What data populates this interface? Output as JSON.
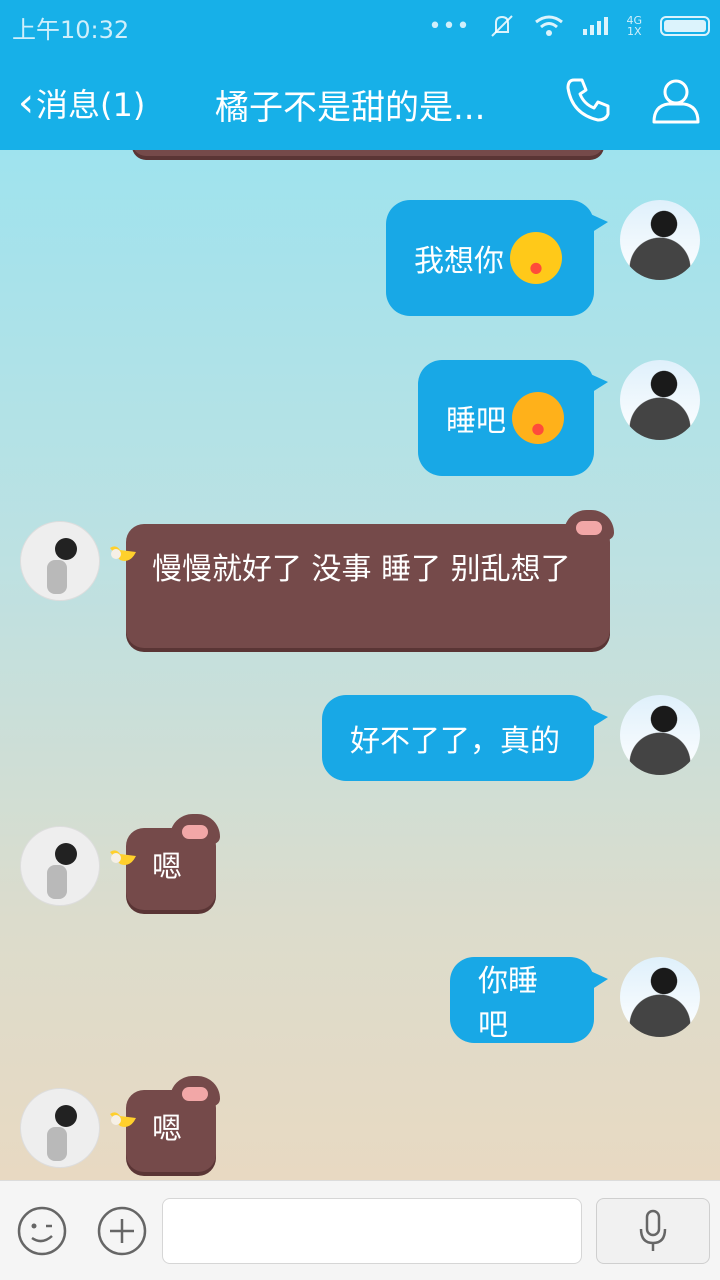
{
  "status_bar": {
    "time": "上午10:32",
    "network_top": "4G",
    "network_bottom": "1X"
  },
  "header": {
    "back_label": "消息(1)",
    "title": "橘子不是甜的是..."
  },
  "messages": [
    {
      "sender": "me",
      "text": "我想你",
      "emoji": "crying-face"
    },
    {
      "sender": "me",
      "text": "睡吧",
      "emoji": "angry-face"
    },
    {
      "sender": "her",
      "text": "慢慢就好了 没事  睡了 别乱想了"
    },
    {
      "sender": "me",
      "text": "好不了了，真的"
    },
    {
      "sender": "her",
      "text": "嗯"
    },
    {
      "sender": "me",
      "text": "你睡吧"
    },
    {
      "sender": "her",
      "text": "嗯"
    }
  ],
  "input": {
    "value": "",
    "placeholder": ""
  },
  "colors": {
    "accent": "#17b0e8",
    "my_bubble": "#18a8e6",
    "her_bubble": "#754a4a"
  }
}
